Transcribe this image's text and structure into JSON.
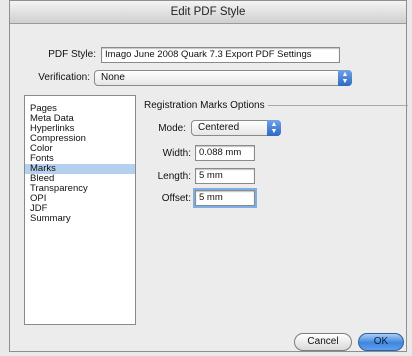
{
  "window": {
    "title": "Edit PDF Style"
  },
  "pdf_style": {
    "label": "PDF Style:",
    "value": "Imago June 2008 Quark 7.3 Export PDF Settings"
  },
  "verification": {
    "label": "Verification:",
    "value": "None"
  },
  "sidebar": {
    "items": [
      {
        "label": "Pages"
      },
      {
        "label": "Meta Data"
      },
      {
        "label": "Hyperlinks"
      },
      {
        "label": "Compression"
      },
      {
        "label": "Color"
      },
      {
        "label": "Fonts"
      },
      {
        "label": "Marks",
        "selected": true
      },
      {
        "label": "Bleed"
      },
      {
        "label": "Transparency"
      },
      {
        "label": "OPI"
      },
      {
        "label": "JDF"
      },
      {
        "label": "Summary"
      }
    ]
  },
  "registration": {
    "group_title": "Registration Marks Options",
    "mode": {
      "label": "Mode:",
      "value": "Centered"
    },
    "width": {
      "label": "Width:",
      "value": "0.088 mm"
    },
    "length": {
      "label": "Length:",
      "value": "5 mm"
    },
    "offset": {
      "label": "Offset:",
      "value": "5 mm"
    }
  },
  "buttons": {
    "cancel": "Cancel",
    "ok": "OK"
  },
  "colors": {
    "selection": "#b5d0ee",
    "accent": "#3f86de"
  }
}
